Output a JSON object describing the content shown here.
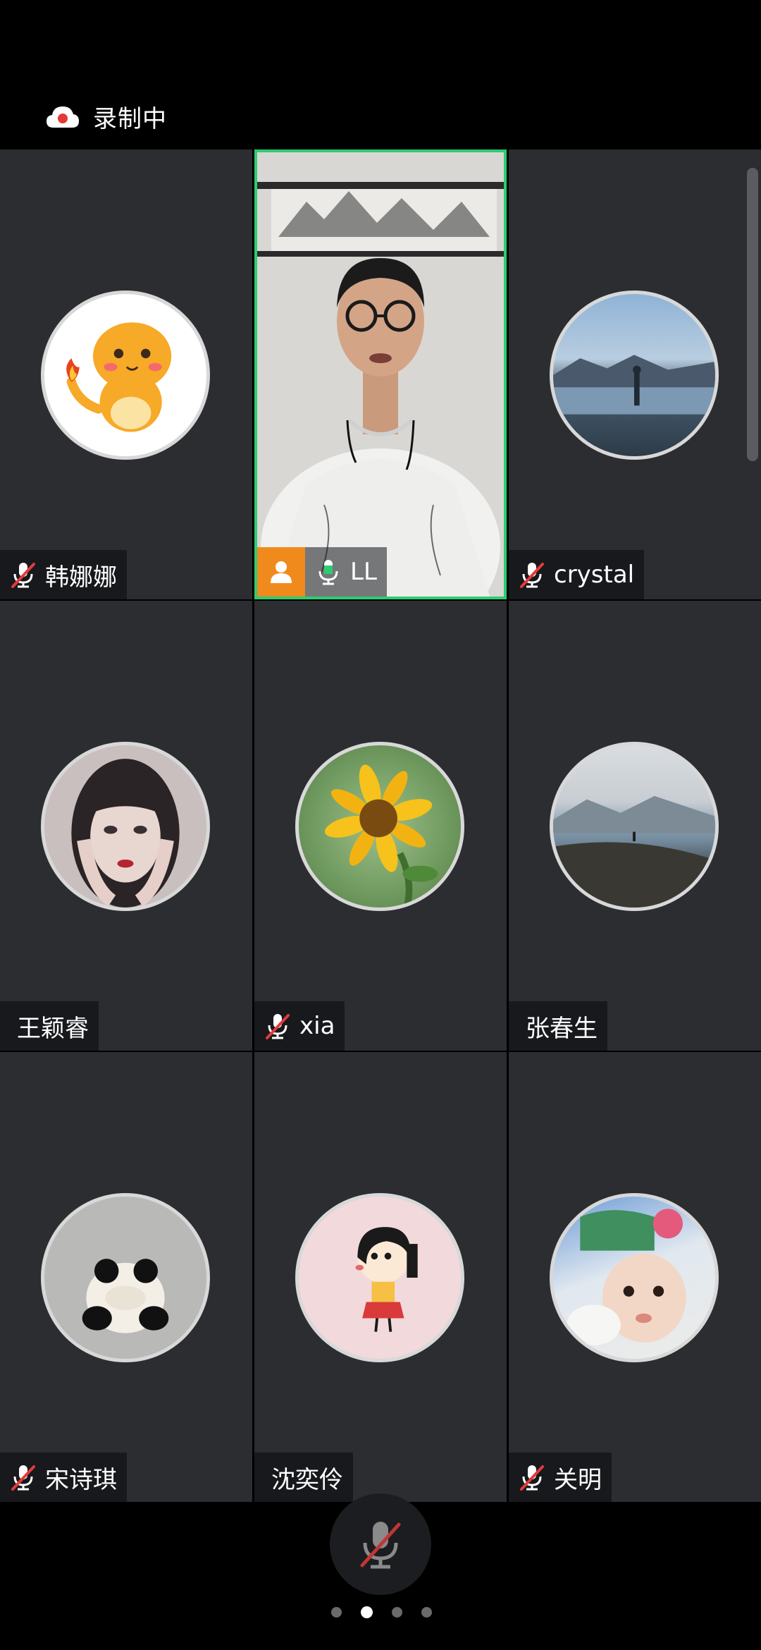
{
  "status": {
    "recording_label": "录制中"
  },
  "participants": [
    {
      "name": "韩娜娜",
      "mic": "muted",
      "avatar": "charmander-avatar"
    },
    {
      "name": "LL",
      "mic": "active",
      "avatar": "camera-video",
      "host": true,
      "speaking": true
    },
    {
      "name": "crystal",
      "mic": "muted",
      "avatar": "lake-landscape-avatar"
    },
    {
      "name": "王颖睿",
      "mic": "none",
      "avatar": "girl-portrait-avatar"
    },
    {
      "name": "xia",
      "mic": "muted",
      "avatar": "sunflower-avatar"
    },
    {
      "name": "张春生",
      "mic": "none",
      "avatar": "mountain-lake-avatar"
    },
    {
      "name": "宋诗琪",
      "mic": "muted",
      "avatar": "panda-avatar"
    },
    {
      "name": "沈奕伶",
      "mic": "none",
      "avatar": "cartoon-girl-avatar"
    },
    {
      "name": "关明",
      "mic": "muted",
      "avatar": "baby-avatar"
    }
  ],
  "controls": {
    "mic_button": "muted-mic-icon"
  },
  "pagination": {
    "total": 4,
    "current": 2
  },
  "colors": {
    "accent_green": "#2ecc71",
    "host_badge": "#f08a1d",
    "muted_red": "#e23b3b",
    "tile_bg": "#2b2d31"
  }
}
